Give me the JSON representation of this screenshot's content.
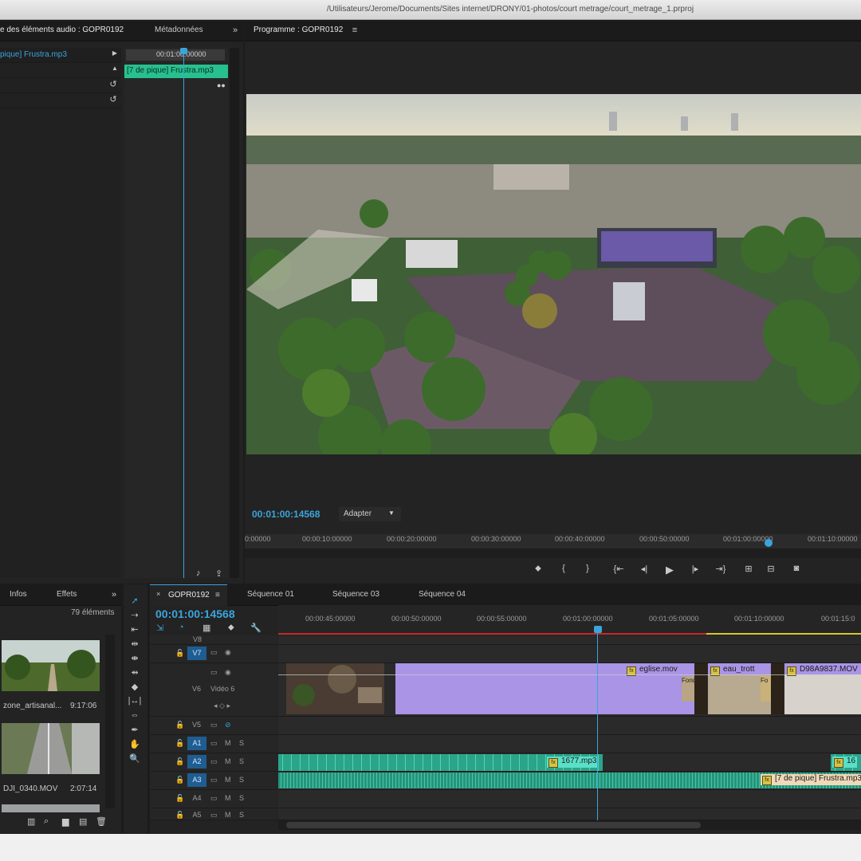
{
  "window": {
    "path": "/Utilisateurs/Jerome/Documents/Sites internet/DRONY/01-photos/court metrage/court_metrage_1.prproj"
  },
  "effects_panel": {
    "tab_effect_controls": "e des éléments audio : GOPR0192",
    "tab_metadata": "Métadonnées",
    "clip_name": "pique] Frustra.mp3",
    "ruler_time": "00:01:00:00000",
    "clip_bar": "[7 de pique] Frustra.mp3"
  },
  "program": {
    "tab": "Programme : GOPR0192",
    "timecode": "00:01:00:14568",
    "fit": "Adapter",
    "ruler": [
      "0:00000",
      "00:00:10:00000",
      "00:00:20:00000",
      "00:00:30:00000",
      "00:00:40:00000",
      "00:00:50:00000",
      "00:01:00:00000",
      "00:01:10:00000"
    ],
    "playhead_fraction": 0.85
  },
  "project": {
    "tab_infos": "Infos",
    "tab_effects": "Effets",
    "count": "79 éléments",
    "items": [
      {
        "name": "zone_artisanal...",
        "duration": "9:17:06",
        "icon": "video-thumbnail"
      },
      {
        "name": "DJI_0340.MOV",
        "duration": "2:07:14",
        "icon": "video-thumbnail"
      }
    ]
  },
  "timeline": {
    "tabs": [
      "GOPR0192",
      "Séquence 01",
      "Séquence 03",
      "Séquence 04"
    ],
    "timecode": "00:01:00:14568",
    "ruler": [
      "00:00:45:00000",
      "00:00:50:00000",
      "00:00:55:00000",
      "00:01:00:00000",
      "00:01:05:00000",
      "00:01:10:00000",
      "00:01:15:0"
    ],
    "tracks": {
      "v8": "V8",
      "v7": "V7",
      "v6": "V6",
      "v6_name": "Vidéo 6",
      "v5": "V5",
      "a1": "A1",
      "a2": "A2",
      "a3": "A3",
      "a4": "A4",
      "a5": "A5",
      "m": "M",
      "s": "S"
    },
    "clips": {
      "eglise": "eglise.mov",
      "eau": "eau_trott",
      "d98": "D98A9837.MOV",
      "fondu": "Fondu",
      "fo": "Fo",
      "mp3_1677": "1677.mp3",
      "mp3_16": "16",
      "frustra": "[7 de pique] Frustra.mp3"
    }
  },
  "colors": {
    "accent_blue": "#3aa5dc",
    "video_clip": "#a994e6",
    "audio_clip": "#2aa58a",
    "effect_clip_bar": "#27c08f"
  }
}
